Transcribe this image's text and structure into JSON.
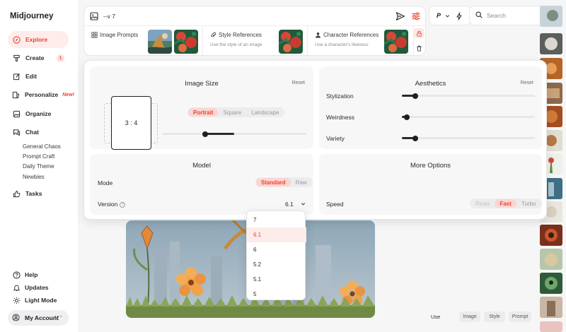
{
  "app": {
    "title": "Midjourney"
  },
  "sidebar": {
    "items": [
      {
        "label": "Explore",
        "icon": "compass-icon"
      },
      {
        "label": "Create",
        "icon": "brush-icon",
        "badge": "1"
      },
      {
        "label": "Edit",
        "icon": "edit-icon"
      },
      {
        "label": "Personalize",
        "icon": "personalize-icon",
        "badge": "New!"
      },
      {
        "label": "Organize",
        "icon": "image-icon"
      },
      {
        "label": "Chat",
        "icon": "chat-icon"
      }
    ],
    "chat_rooms": [
      "General Chaos",
      "Prompt Craft",
      "Daily Theme",
      "Newbies"
    ],
    "tasks": {
      "label": "Tasks",
      "icon": "thumbs-up-icon"
    },
    "bottom": [
      {
        "label": "Help",
        "icon": "help-icon"
      },
      {
        "label": "Updates",
        "icon": "bell-icon"
      },
      {
        "label": "Light Mode",
        "icon": "sun-icon"
      }
    ],
    "account": {
      "label": "My Account",
      "menu": "···"
    }
  },
  "prompt": {
    "value": "--v 7",
    "references": [
      {
        "title": "Image Prompts",
        "subtitle": ""
      },
      {
        "title": "Style References",
        "subtitle": "Use the style of an image"
      },
      {
        "title": "Character References",
        "subtitle": "Use a character's likeness"
      }
    ]
  },
  "topbar": {
    "mode_letter": "P",
    "search_placeholder": "Search"
  },
  "settings": {
    "image_size": {
      "title": "Image Size",
      "reset": "Reset",
      "aspect_ratio": "3 : 4",
      "orientation_options": [
        "Portrait",
        "Square",
        "Landscape"
      ],
      "orientation_selected": "Portrait",
      "size_slider_value": 0.5
    },
    "aesthetics": {
      "title": "Aesthetics",
      "reset": "Reset",
      "sliders": [
        {
          "label": "Stylization",
          "value": 0.1
        },
        {
          "label": "Weirdness",
          "value": 0.03
        },
        {
          "label": "Variety",
          "value": 0.1
        }
      ]
    },
    "model": {
      "title": "Model",
      "mode_label": "Mode",
      "mode_options": [
        "Standard",
        "Raw"
      ],
      "mode_selected": "Standard",
      "version_label": "Version",
      "version_value": "6.1"
    },
    "more_options": {
      "title": "More Options",
      "speed_label": "Speed",
      "speed_options": [
        "Relax",
        "Fast",
        "Turbo"
      ],
      "speed_selected": "Fast"
    }
  },
  "version_dropdown": {
    "options": [
      "7",
      "6.1",
      "6",
      "5.2",
      "5.1",
      "5"
    ],
    "selected": "6.1"
  },
  "use_bar": {
    "label": "Use",
    "buttons": [
      "Image",
      "Style",
      "Prompt"
    ]
  },
  "colors": {
    "accent": "#e5453a",
    "accent_bg": "#fdecea"
  }
}
